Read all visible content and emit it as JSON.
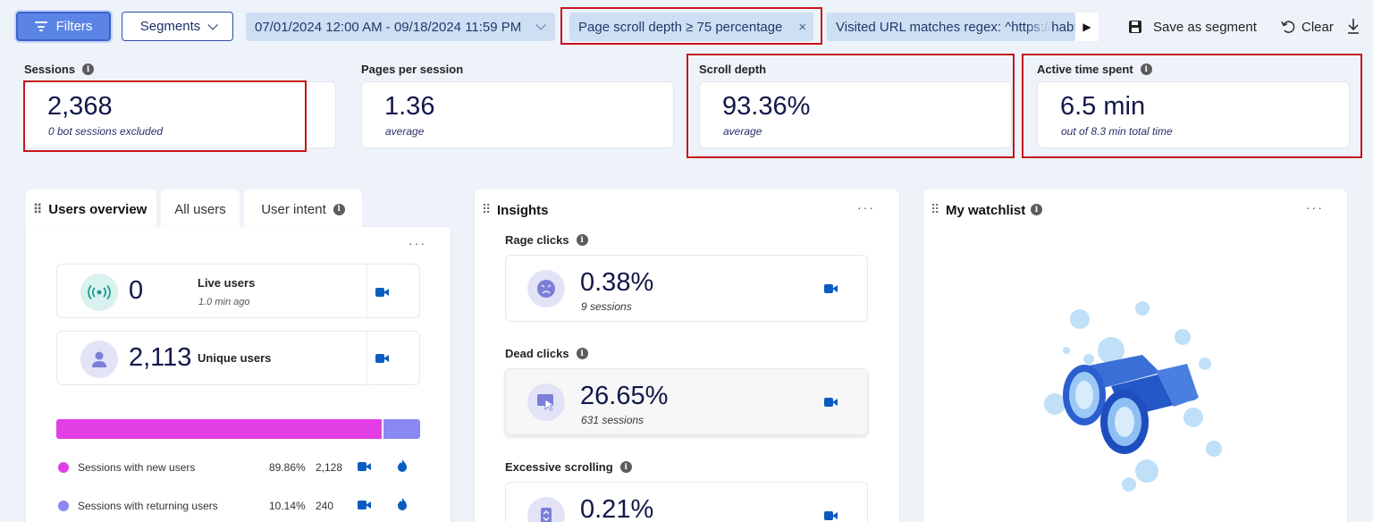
{
  "toolbar": {
    "filters_label": "Filters",
    "segments_label": "Segments",
    "date_range": "07/01/2024 12:00 AM - 09/18/2024 11:59 PM",
    "scroll_filter": "Page scroll depth ≥ 75 percentage",
    "url_filter": "Visited URL matches regex: ^https://hab",
    "url_filter_faded": "th",
    "save_segment_label": "Save as segment",
    "clear_label": "Clear"
  },
  "stats": {
    "sessions": {
      "label": "Sessions",
      "value": "2,368",
      "sub": "0 bot sessions excluded"
    },
    "pages_per_session": {
      "label": "Pages per session",
      "value": "1.36",
      "sub": "average"
    },
    "scroll_depth": {
      "label": "Scroll depth",
      "value": "93.36%",
      "sub": "average"
    },
    "active_time": {
      "label": "Active time spent",
      "value": "6.5 min",
      "sub": "out of 8.3 min total time"
    }
  },
  "users_panel": {
    "tabs": [
      "Users overview",
      "All users",
      "User intent"
    ],
    "live_users": {
      "value": "0",
      "label": "Live users",
      "sub": "1.0 min ago"
    },
    "unique_users": {
      "value": "2,113",
      "label": "Unique users"
    },
    "split": {
      "new_fraction": 0.8986,
      "new_color": "#e23ee6",
      "returning_color": "#8a88f2"
    },
    "legend": [
      {
        "label": "Sessions with new users",
        "percent": "89.86%",
        "count": "2,128",
        "color": "#e23ee6"
      },
      {
        "label": "Sessions with returning users",
        "percent": "10.14%",
        "count": "240",
        "color": "#8a88f2"
      }
    ]
  },
  "insights_panel": {
    "title": "Insights",
    "items": [
      {
        "title": "Rage clicks",
        "value": "0.38%",
        "sub": "9 sessions"
      },
      {
        "title": "Dead clicks",
        "value": "26.65%",
        "sub": "631 sessions"
      },
      {
        "title": "Excessive scrolling",
        "value": "0.21%",
        "sub": ""
      }
    ]
  },
  "watchlist_panel": {
    "title": "My watchlist"
  },
  "icons": {
    "info": "i",
    "more": "···",
    "drag": "⠿",
    "close": "×",
    "arrow": "▶"
  }
}
